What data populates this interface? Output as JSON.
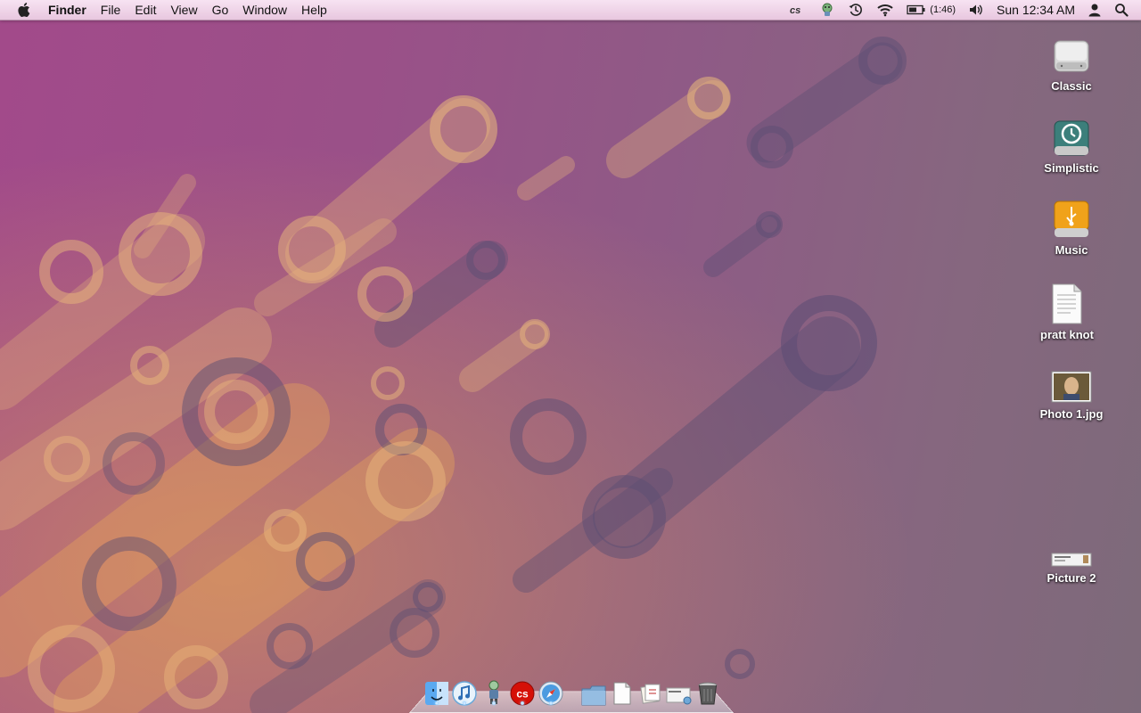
{
  "menubar": {
    "apple_icon": "apple-icon",
    "app_name": "Finder",
    "menus": [
      "File",
      "Edit",
      "View",
      "Go",
      "Window",
      "Help"
    ],
    "status": {
      "lastfm": "lastfm-icon",
      "battery_time": "(1:46)",
      "clock": "Sun 12:34 AM"
    }
  },
  "desktop": {
    "icons": [
      {
        "label": "Classic",
        "icon": "hard-drive-icon"
      },
      {
        "label": "Simplistic",
        "icon": "time-machine-drive-icon"
      },
      {
        "label": "Music",
        "icon": "usb-drive-icon"
      },
      {
        "label": "pratt knot",
        "icon": "document-icon"
      },
      {
        "label": "Photo 1.jpg",
        "icon": "photo-thumbnail-icon"
      },
      {
        "label": "Picture 2",
        "icon": "screenshot-thumbnail-icon"
      }
    ]
  },
  "dock": {
    "items": [
      {
        "name": "Finder",
        "icon": "finder-icon",
        "running": true
      },
      {
        "name": "iTunes",
        "icon": "itunes-icon",
        "running": true
      },
      {
        "name": "Robot app",
        "icon": "robot-app-icon",
        "running": true
      },
      {
        "name": "Last.fm",
        "icon": "lastfm-app-icon",
        "running": true
      },
      {
        "name": "Safari",
        "icon": "safari-icon",
        "running": true
      },
      {
        "name": "Folder",
        "icon": "folder-stack-icon",
        "running": false
      },
      {
        "name": "Documents",
        "icon": "documents-stack-icon",
        "running": false
      },
      {
        "name": "Mail",
        "icon": "mail-stack-icon",
        "running": false
      },
      {
        "name": "Screenshots",
        "icon": "screenshots-stack-icon",
        "running": false
      },
      {
        "name": "Trash",
        "icon": "trash-icon",
        "running": false
      }
    ]
  },
  "colors": {
    "menubar_top": "#f7e3f2",
    "wallpaper_magenta": "#a24a8a",
    "wallpaper_gray": "#7d6a7a",
    "ring_orange": "#e3a855",
    "ring_dark": "#5a4a72"
  }
}
